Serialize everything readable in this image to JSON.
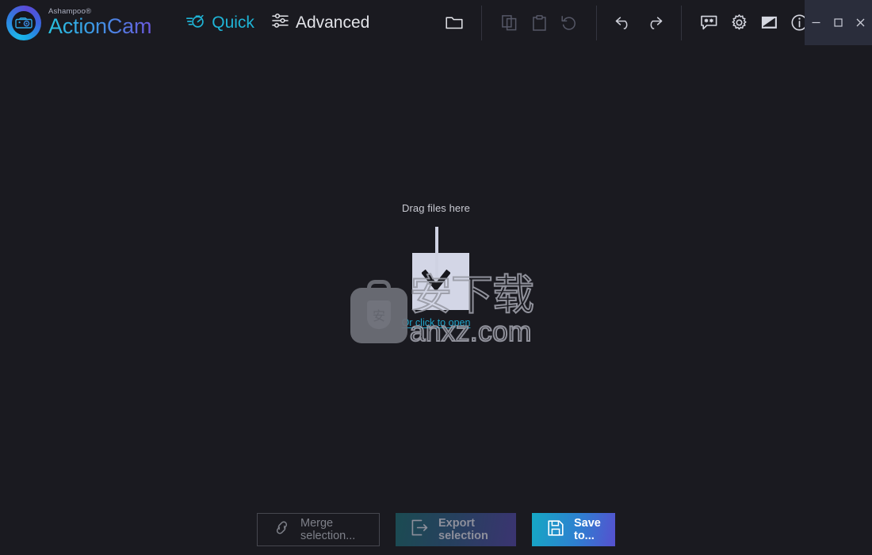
{
  "app": {
    "brand": "Ashampoo®",
    "name": "ActionCam"
  },
  "mode_tabs": [
    {
      "label": "Quick",
      "icon": "stopwatch-speed-icon",
      "state": "active",
      "color": "#1fb4d6"
    },
    {
      "label": "Advanced",
      "icon": "sliders-icon",
      "state": "inactive",
      "color": "#e2e3e8"
    }
  ],
  "toolbar": {
    "groups": [
      {
        "buttons": [
          {
            "name": "open-folder-button",
            "icon": "folder-icon",
            "enabled": true
          }
        ]
      },
      {
        "buttons": [
          {
            "name": "copy-button",
            "icon": "copy-icon",
            "enabled": false
          },
          {
            "name": "paste-button",
            "icon": "clipboard-paste-icon",
            "enabled": false
          },
          {
            "name": "reset-button",
            "icon": "reset-circular-arrow-icon",
            "enabled": false
          }
        ]
      },
      {
        "buttons": [
          {
            "name": "undo-button",
            "icon": "undo-arrow-icon",
            "enabled": true
          },
          {
            "name": "redo-button",
            "icon": "redo-arrow-icon",
            "enabled": true
          }
        ]
      },
      {
        "buttons": [
          {
            "name": "feedback-button",
            "icon": "speech-bubble-stars-icon",
            "enabled": true
          },
          {
            "name": "settings-button",
            "icon": "gear-icon",
            "enabled": true
          },
          {
            "name": "theme-button",
            "icon": "contrast-theme-icon",
            "enabled": true
          },
          {
            "name": "info-button",
            "icon": "info-circle-icon",
            "enabled": true
          }
        ]
      }
    ]
  },
  "window_controls": [
    {
      "name": "minimize-button",
      "icon": "minimize-icon"
    },
    {
      "name": "maximize-button",
      "icon": "maximize-square-icon"
    },
    {
      "name": "close-button",
      "icon": "close-x-icon"
    }
  ],
  "dropzone": {
    "drag_label": "Drag files here",
    "link_label": "Or click to open",
    "icon": "download-arrow-into-tray-icon"
  },
  "watermark": {
    "cn_text": "安下载",
    "url_text": "anxz.com",
    "badge_char": "安",
    "bag_icon": "software-bag-shield-icon"
  },
  "footer_buttons": [
    {
      "name": "merge-selection-button",
      "label": "Merge selection...",
      "icon": "chain-link-icon",
      "enabled": false
    },
    {
      "name": "export-selection-button",
      "label": "Export selection",
      "icon": "export-arrow-icon",
      "enabled": false
    },
    {
      "name": "save-to-button",
      "label": "Save to...",
      "icon": "floppy-disk-icon",
      "enabled": true
    }
  ],
  "colors": {
    "background": "#1a1a20",
    "accent_teal": "#1fb4d6",
    "link": "#1fa3c8",
    "titlebar_controls_bg": "#2a2d3b",
    "save_gradient_from": "#15a8c4",
    "save_gradient_to": "#5650cf",
    "separator": "#33343f"
  }
}
